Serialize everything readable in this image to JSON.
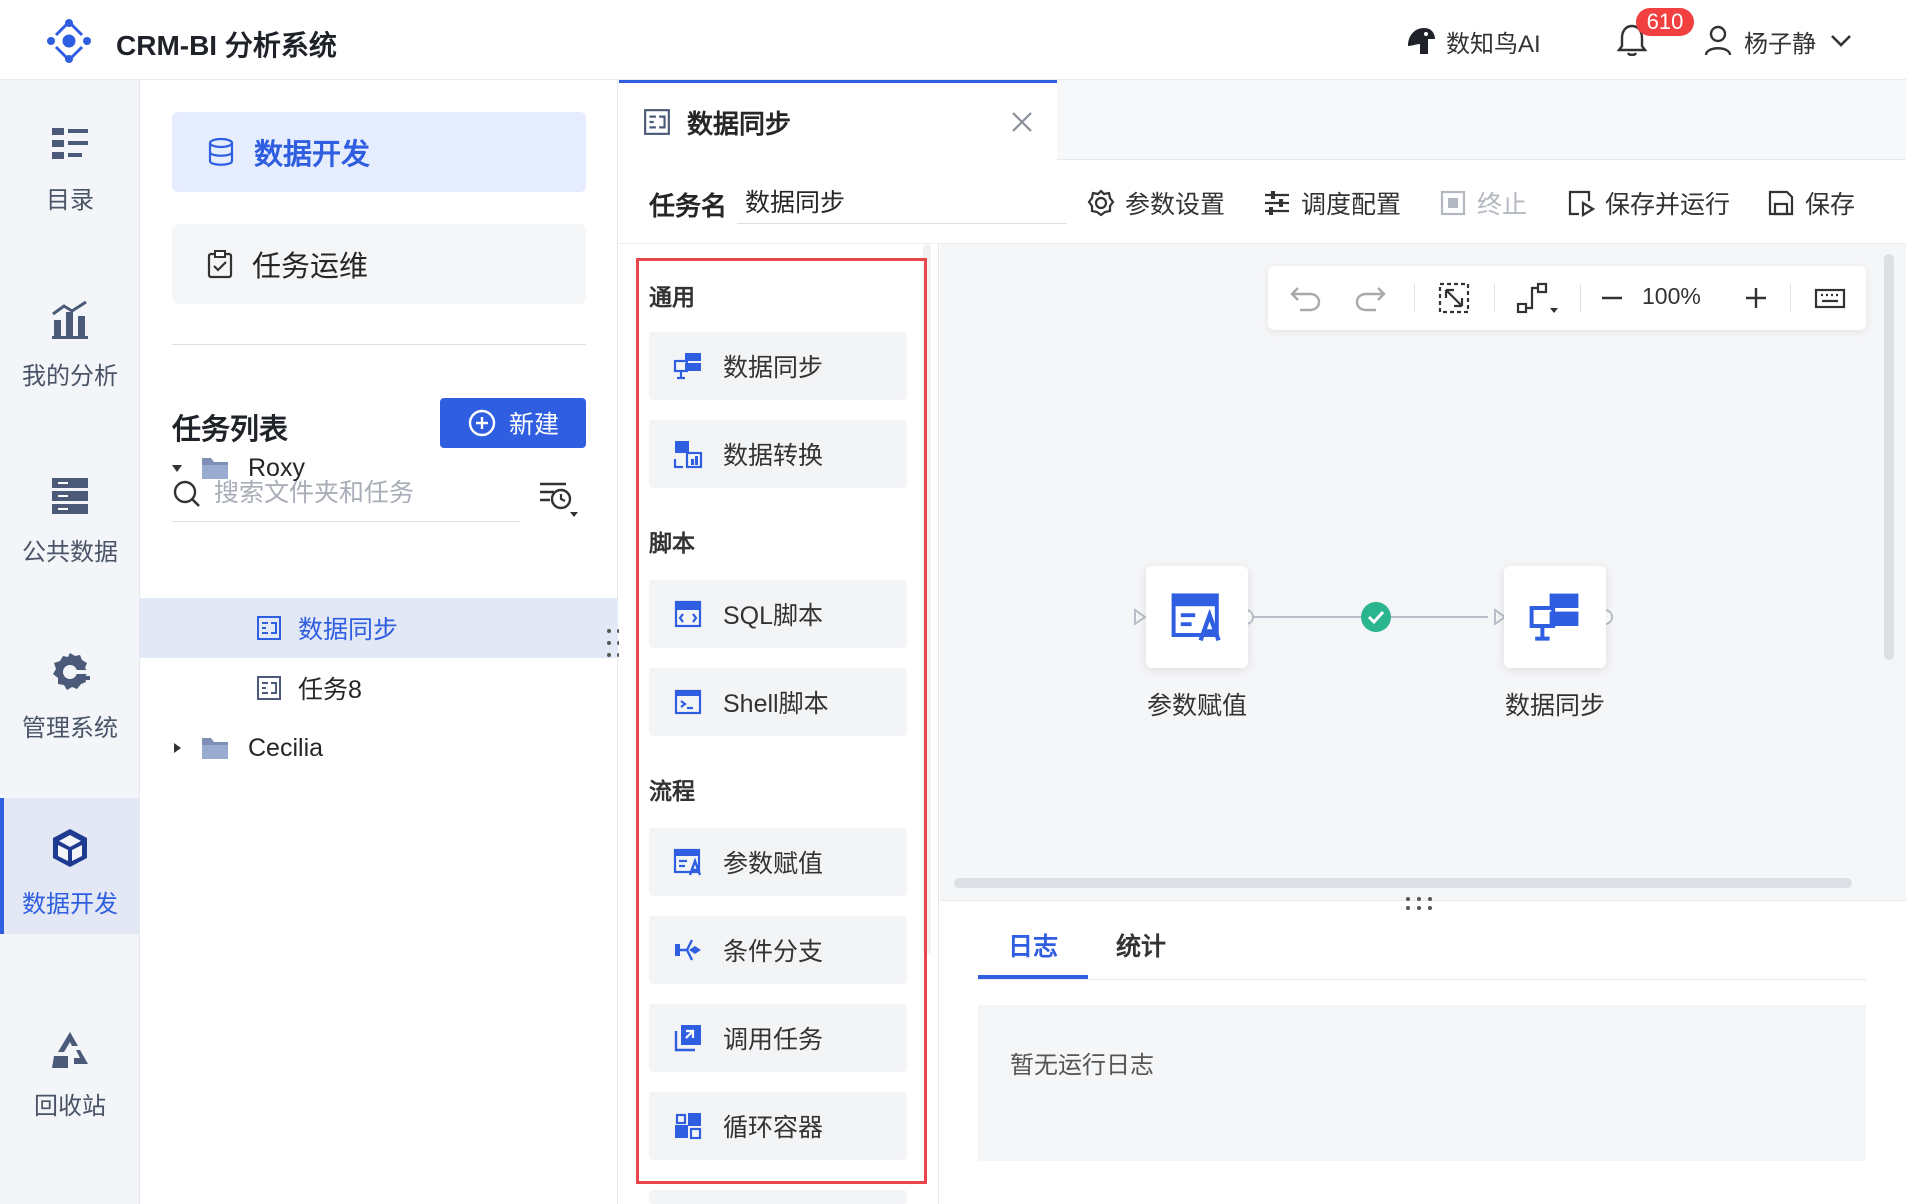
{
  "header": {
    "app_title": "CRM-BI 分析系统",
    "ai_label": "数知鸟AI",
    "notification_count": "610",
    "user_name": "杨子静"
  },
  "rail": {
    "items": [
      {
        "label": "目录",
        "icon": "list-icon"
      },
      {
        "label": "我的分析",
        "icon": "chart-icon"
      },
      {
        "label": "公共数据",
        "icon": "database-icon"
      },
      {
        "label": "管理系统",
        "icon": "gear-icon"
      },
      {
        "label": "数据开发",
        "icon": "cube-icon",
        "active": true
      },
      {
        "label": "回收站",
        "icon": "recycle-icon"
      }
    ]
  },
  "panel2": {
    "menu": [
      {
        "label": "数据开发",
        "active": true
      },
      {
        "label": "任务运维"
      }
    ],
    "task_list_title": "任务列表",
    "new_button": "新建",
    "search_placeholder": "搜索文件夹和任务",
    "tree": [
      {
        "label": "Roxy",
        "type": "folder",
        "expanded": true
      },
      {
        "label": "数据同步",
        "type": "task",
        "selected": true
      },
      {
        "label": "任务8",
        "type": "task"
      },
      {
        "label": "Cecilia",
        "type": "folder",
        "expanded": false
      }
    ]
  },
  "tab": {
    "title": "数据同步"
  },
  "toolbar": {
    "task_name_label": "任务名",
    "task_name_value": "数据同步",
    "params": "参数设置",
    "schedule": "调度配置",
    "stop": "终止",
    "save_run": "保存并运行",
    "save": "保存"
  },
  "palette": {
    "groups": [
      {
        "title": "通用",
        "items": [
          "数据同步",
          "数据转换"
        ]
      },
      {
        "title": "脚本",
        "items": [
          "SQL脚本",
          "Shell脚本"
        ]
      },
      {
        "title": "流程",
        "items": [
          "参数赋值",
          "条件分支",
          "调用任务",
          "循环容器"
        ]
      }
    ]
  },
  "canvas": {
    "zoom": "100%",
    "nodes": [
      {
        "label": "参数赋值"
      },
      {
        "label": "数据同步"
      }
    ]
  },
  "bottom": {
    "tabs": [
      "日志",
      "统计"
    ],
    "empty_log": "暂无运行日志"
  },
  "colors": {
    "primary": "#2f5fe0",
    "badge": "#f23f3f",
    "highlight": "#e8464b",
    "success": "#2bb58f"
  }
}
